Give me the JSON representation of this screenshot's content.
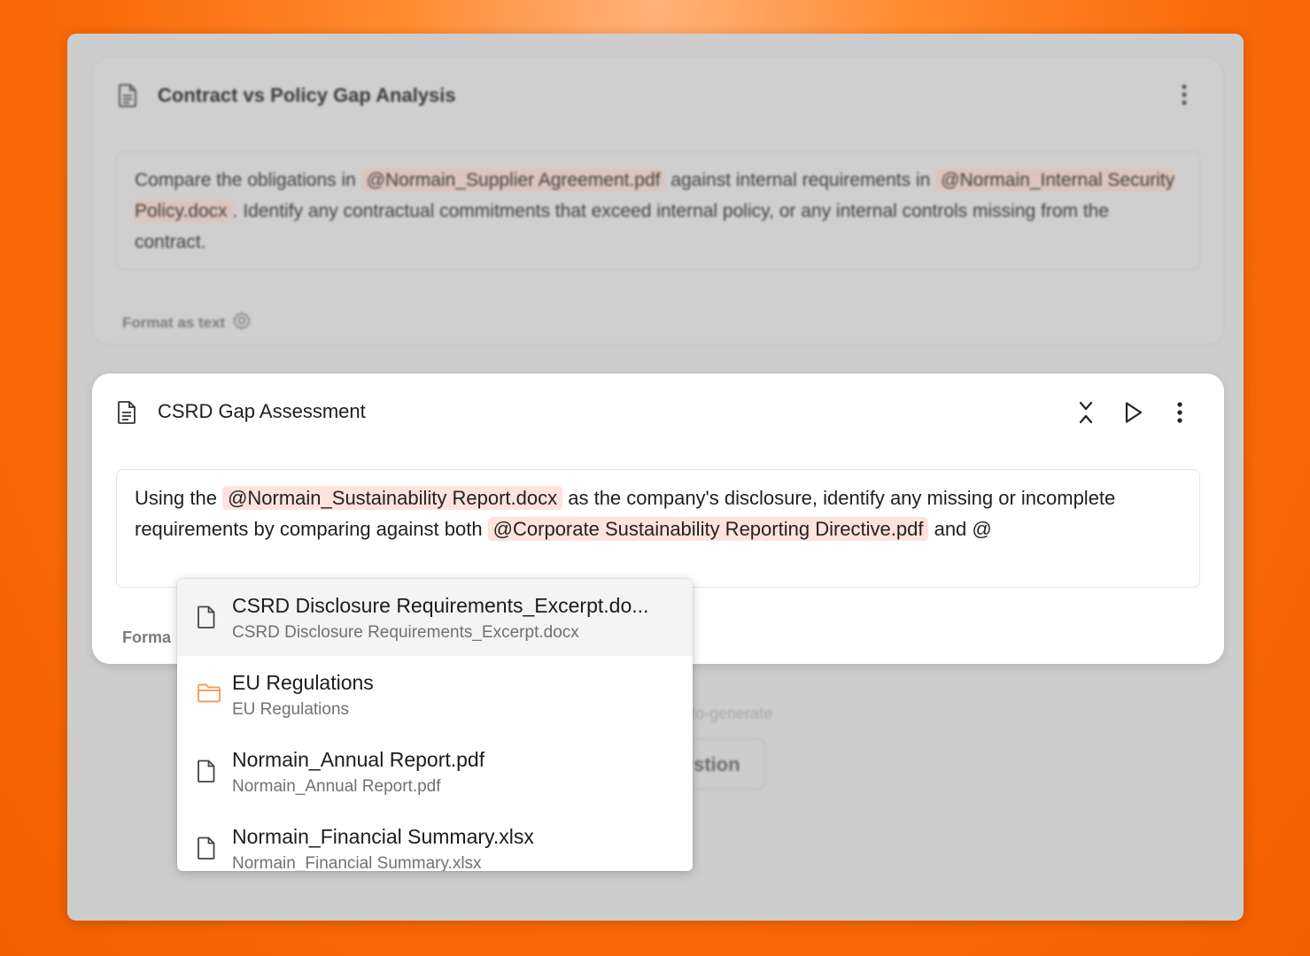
{
  "background_card": {
    "title": "Contract vs Policy Gap Analysis",
    "prompt": {
      "t1": "Compare the obligations in ",
      "m1": "@Normain_Supplier Agreement.pdf",
      "t2": " against internal requirements in ",
      "m2": "@Normain_Internal Security Policy.docx",
      "t3": ". Identify any contractual commitments that exceed internal policy, or any internal controls missing from the contract."
    },
    "format_label": "Format as text"
  },
  "behind": {
    "note": "uto-generate",
    "button": "stion"
  },
  "active_card": {
    "title": "CSRD Gap Assessment",
    "prompt": {
      "t1": "Using the ",
      "m1": "@Normain_Sustainability Report.docx",
      "t2": " as the company's disclosure, identify any missing or incomplete requirements by comparing against both ",
      "m2": "@Corporate Sustainability Reporting Directive.pdf",
      "t3": " and @"
    },
    "format_label": "Forma"
  },
  "mention_dropdown": {
    "items": [
      {
        "title": "CSRD Disclosure Requirements_Excerpt.do...",
        "subtitle": "CSRD Disclosure Requirements_Excerpt.docx",
        "icon": "file-icon"
      },
      {
        "title": "EU Regulations",
        "subtitle": "EU Regulations",
        "icon": "folder-icon"
      },
      {
        "title": "Normain_Annual Report.pdf",
        "subtitle": "Normain_Annual Report.pdf",
        "icon": "file-icon"
      },
      {
        "title": "Normain_Financial Summary.xlsx",
        "subtitle": "Normain_Financial Summary.xlsx",
        "icon": "file-icon"
      }
    ]
  },
  "colors": {
    "background": "#f96a0a",
    "mention_chip": "#fde3dc",
    "folder": "#f0a060"
  }
}
